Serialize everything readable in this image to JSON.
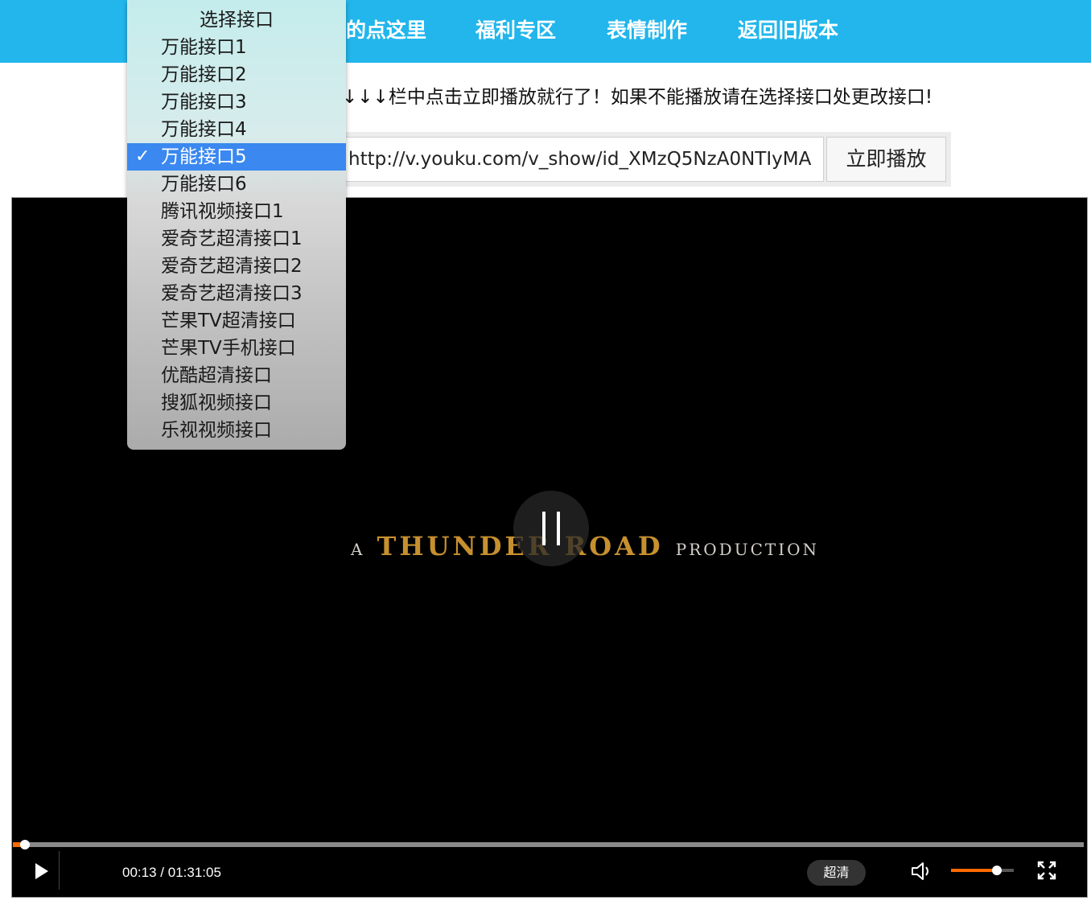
{
  "nav": {
    "items": [
      {
        "label": "的点这里"
      },
      {
        "label": "福利专区"
      },
      {
        "label": "表情制作"
      },
      {
        "label": "返回旧版本"
      }
    ]
  },
  "instruction": {
    "text": "↓↓↓栏中点击立即播放就行了！如果不能播放请在选择接口处更改接口!"
  },
  "form": {
    "url_value": "http://v.youku.com/v_show/id_XMzQ5NzA0NTIyMA",
    "play_button_label": "立即播放"
  },
  "player": {
    "title_card": {
      "prefix": "A",
      "main": "THUNDER ROAD",
      "suffix": "PRODUCTION"
    },
    "current_time": "00:13",
    "separator": "/",
    "duration": "01:31:05",
    "progress_fraction": 0.011,
    "quality_label": "超清",
    "volume_fraction": 0.73,
    "state": "playing"
  },
  "interface_select": {
    "header": "选择接口",
    "selected_index": 4,
    "options": [
      {
        "label": "万能接口1"
      },
      {
        "label": "万能接口2"
      },
      {
        "label": "万能接口3"
      },
      {
        "label": "万能接口4"
      },
      {
        "label": "万能接口5"
      },
      {
        "label": "万能接口6"
      },
      {
        "label": "腾讯视频接口1"
      },
      {
        "label": "爱奇艺超清接口1"
      },
      {
        "label": "爱奇艺超清接口2"
      },
      {
        "label": "爱奇艺超清接口3"
      },
      {
        "label": "芒果TV超清接口"
      },
      {
        "label": "芒果TV手机接口"
      },
      {
        "label": "优酷超清接口"
      },
      {
        "label": "搜狐视频接口"
      },
      {
        "label": "乐视视频接口"
      }
    ],
    "check_glyph": "✓"
  },
  "colors": {
    "nav_bg": "#22b6ec",
    "accent": "#ff6a00",
    "selected_bg": "#3a88f0",
    "title_gold": "#c7902f"
  }
}
